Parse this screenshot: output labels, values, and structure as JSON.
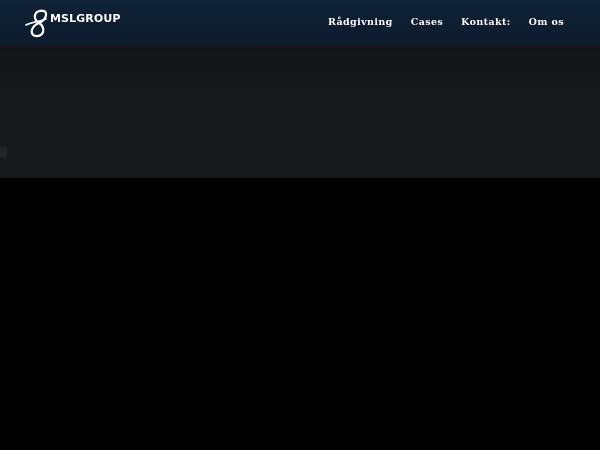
{
  "brand": {
    "logo_text": "MSLGROUP",
    "logo_icon": "infinity-eight-icon"
  },
  "nav": {
    "items": [
      {
        "label": "Rådgivning"
      },
      {
        "label": "Cases"
      },
      {
        "label": "Kontakt:"
      },
      {
        "label": "Om os"
      }
    ]
  },
  "colors": {
    "header_bg": "#0f2236",
    "hero_bg": "#161819",
    "page_bg": "#000000",
    "nav_text": "#ffffff"
  }
}
